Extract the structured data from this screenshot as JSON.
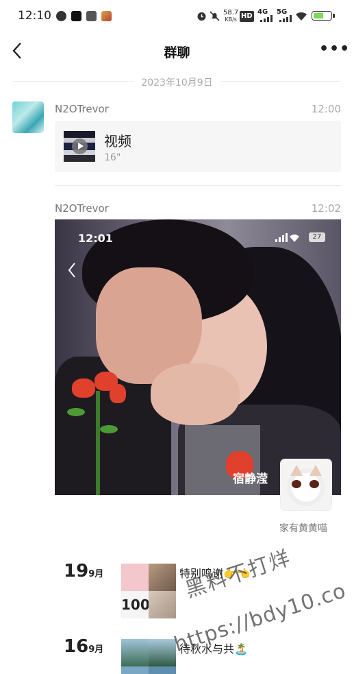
{
  "status_bar": {
    "time": "12:10",
    "net_speed_value": "58.7",
    "net_speed_unit": "KB/s",
    "hd": "HD",
    "hd_sub": "1\n2",
    "sig1": "4G",
    "sig2": "5G",
    "battery_level": 0.62,
    "icons": [
      "globe-icon",
      "tiktok-icon",
      "square-icon",
      "game-icon",
      "alarm-icon",
      "mute-icon",
      "wifi-icon",
      "battery-icon"
    ]
  },
  "nav": {
    "back_icon": "chevron-left-icon",
    "title": "群聊",
    "more_icon": "more-dots-icon",
    "more_label": "•••"
  },
  "date_divider": "2023年10月9日",
  "messages": [
    {
      "sender": "N2OTrevor",
      "time": "12:00",
      "type": "video",
      "title": "视频",
      "duration": "16\""
    },
    {
      "sender": "N2OTrevor",
      "time": "12:02",
      "type": "image",
      "screenshot": {
        "time": "12:01",
        "battery": "27",
        "caption": "宿静滢"
      }
    }
  ],
  "profile_card": {
    "name": "家有黄黄喵"
  },
  "moments": [
    {
      "day": "19",
      "month": "9月",
      "text": "特别鸣谢👉👈",
      "thumb_number": "100"
    },
    {
      "day": "16",
      "month": "9月",
      "text": "待秋水与共🏝️"
    }
  ],
  "watermark": {
    "line1": "黑料不打烊",
    "line2": "https://bdy10.co"
  }
}
